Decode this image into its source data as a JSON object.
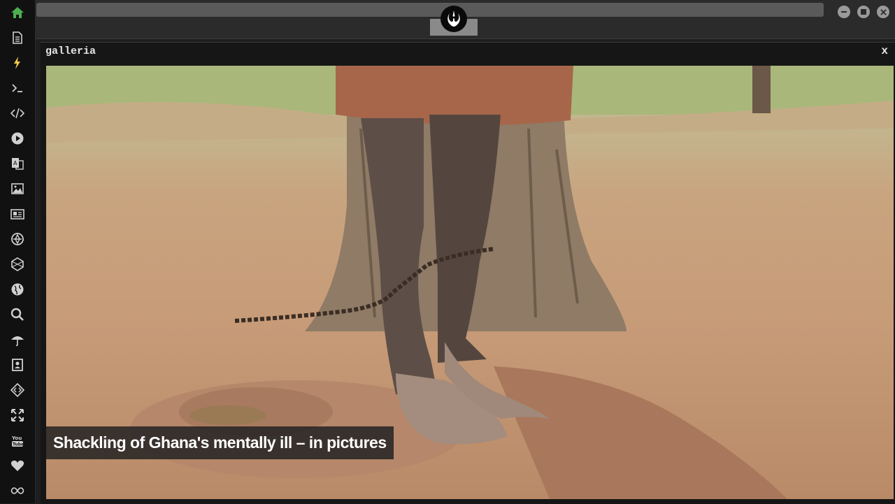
{
  "sidebar": {
    "icons": [
      "home-icon",
      "document-icon",
      "lightning-icon",
      "terminal-icon",
      "code-icon",
      "play-icon",
      "translate-icon",
      "image-icon",
      "news-icon",
      "aperture-icon",
      "hexagon-icon",
      "globe-icon",
      "search-icon",
      "umbrella-icon",
      "contact-card-icon",
      "diamond-code-icon",
      "expand-icon",
      "youtube-icon",
      "heart-icon",
      "infinity-icon"
    ],
    "active_color": "#4caf50",
    "icon_color": "#d0d0d0"
  },
  "topbar": {
    "logo": "rebel-alliance-logo",
    "window_buttons": [
      "minimize",
      "maximize",
      "close"
    ]
  },
  "window": {
    "title": "galleria",
    "close_label": "x"
  },
  "gallery": {
    "caption": "Shackling of Ghana's mentally ill – in pictures"
  }
}
